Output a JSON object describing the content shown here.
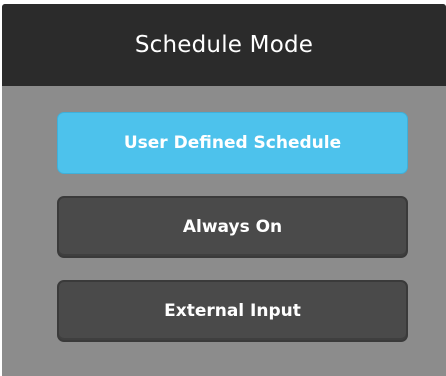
{
  "panel": {
    "title": "Schedule Mode"
  },
  "modes": [
    {
      "label": "User Defined Schedule",
      "selected": true
    },
    {
      "label": "Always On",
      "selected": false
    },
    {
      "label": "External Input",
      "selected": false
    }
  ],
  "colors": {
    "header_bg": "#2b2b2b",
    "panel_bg": "#8c8c8c",
    "selected_bg": "#4dc2ec",
    "button_bg": "#4a4a4a",
    "text": "#ffffff"
  }
}
